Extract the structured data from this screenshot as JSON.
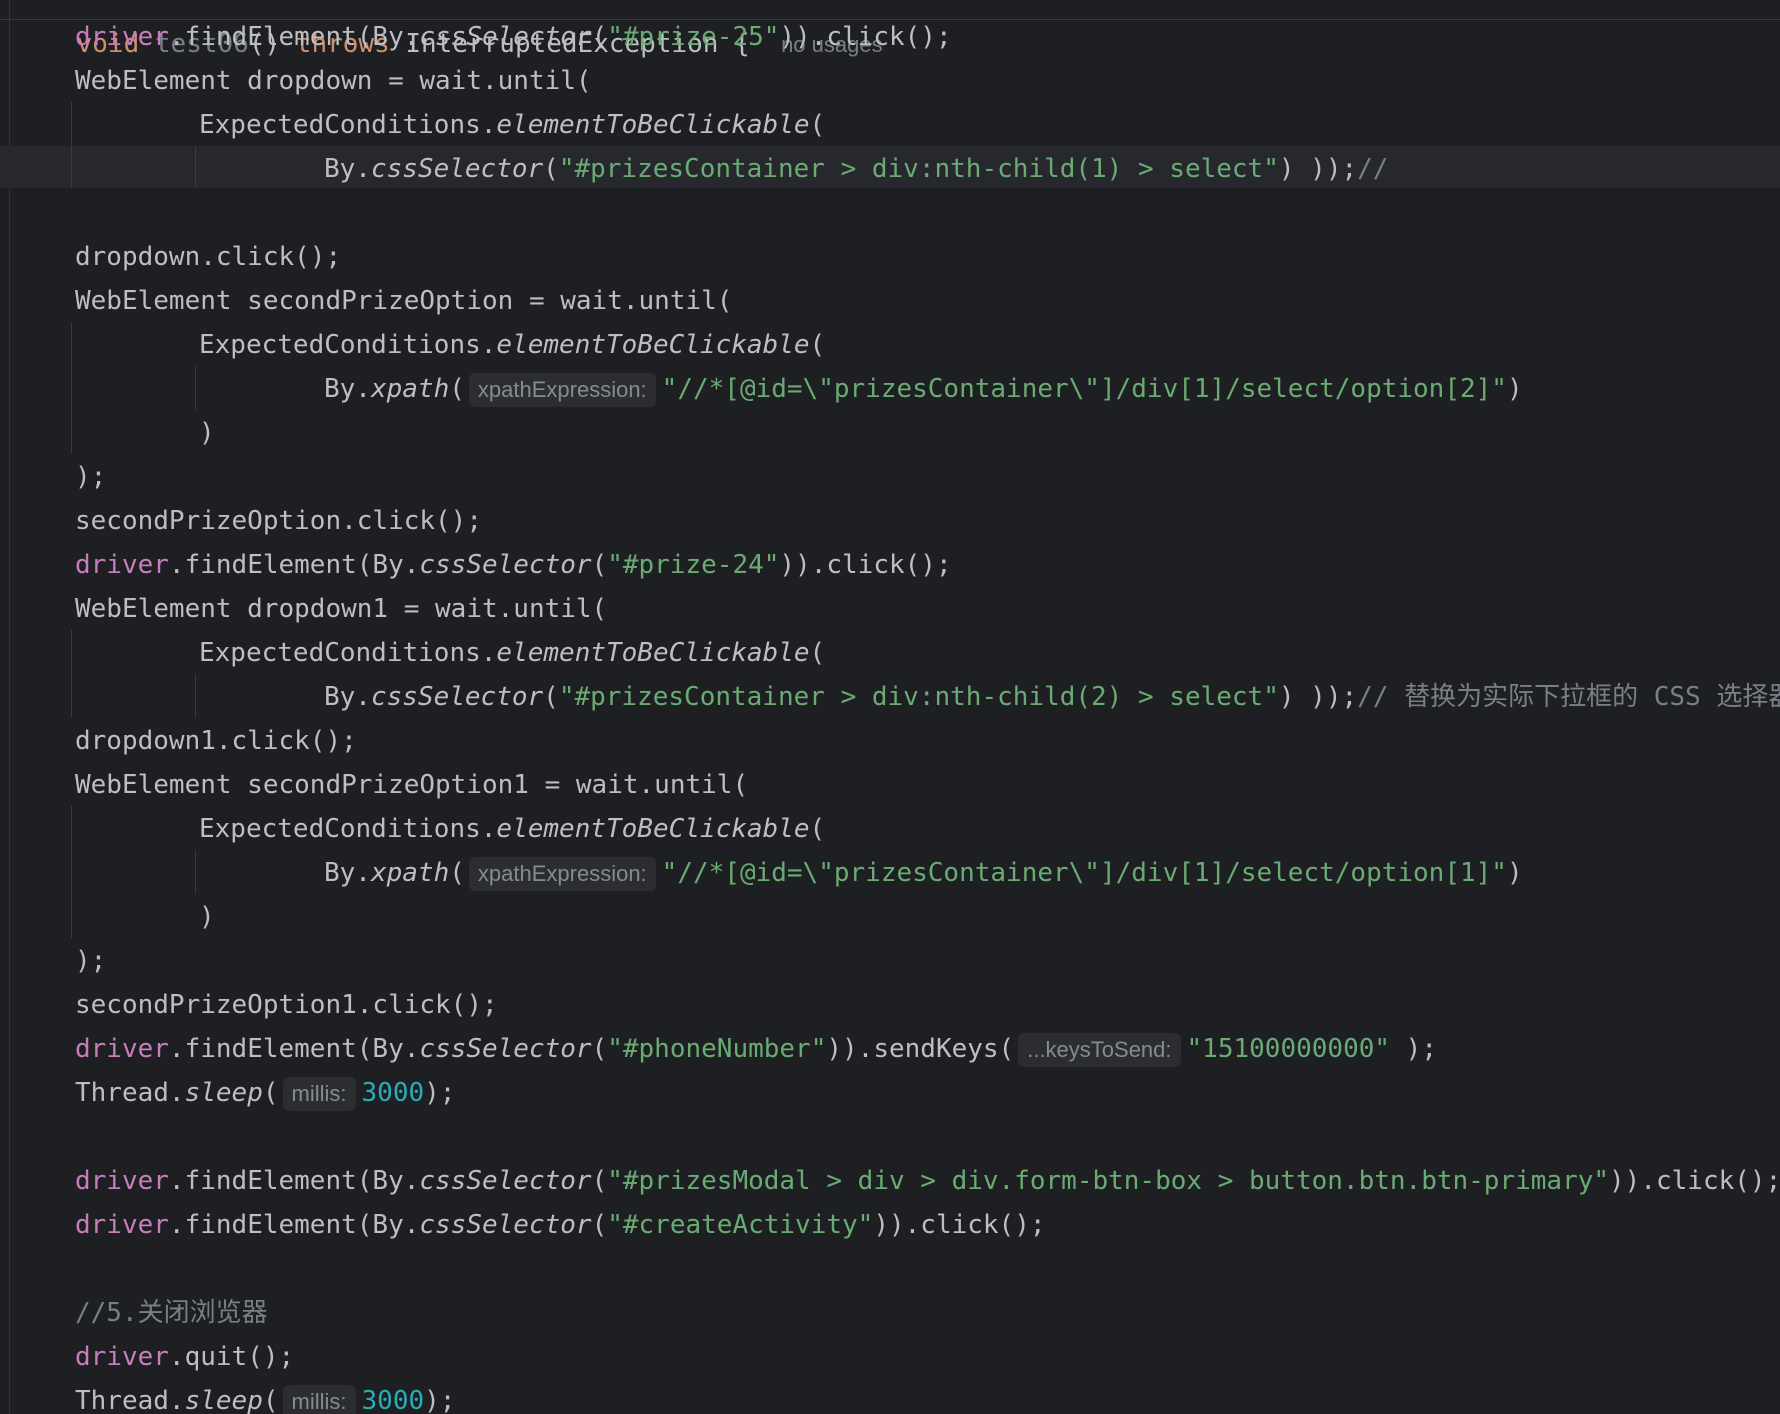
{
  "editor": {
    "header": {
      "kw_void": "void",
      "method": "test06",
      "sig_mid": "() ",
      "kw_throws": "throws",
      "exception": " InterruptedException {",
      "usages": "no usages"
    },
    "hints": {
      "xpath": "xpathExpression:",
      "keys": "...keysToSend:",
      "millis": "millis:"
    },
    "lines": {
      "l1": {
        "drv": "driver",
        "a": ".findElement(By.",
        "fn": "cssSelector",
        "b": "(",
        "s": "\"#prize-25\"",
        "c": ")).click();"
      },
      "l2": {
        "a": "WebElement dropdown = wait.until("
      },
      "l3": {
        "a": "ExpectedConditions.",
        "fn": "elementToBeClickable",
        "b": "("
      },
      "l4": {
        "a": "By.",
        "fn": "cssSelector",
        "b": "(",
        "s": "\"#prizesContainer > div:nth-child(1) > select\"",
        "c": ") ));",
        "cmt": "//"
      },
      "l6": {
        "a": "dropdown.click();"
      },
      "l7": {
        "a": "WebElement secondPrizeOption = wait.until("
      },
      "l8": {
        "a": "ExpectedConditions.",
        "fn": "elementToBeClickable",
        "b": "("
      },
      "l9": {
        "a": "By.",
        "fn": "xpath",
        "b": "(",
        "s": "\"//*[@id=\\\"prizesContainer\\\"]/div[1]/select/option[2]\"",
        "c": ")"
      },
      "l10": {
        "a": ")"
      },
      "l11": {
        "a": ");"
      },
      "l12": {
        "a": "secondPrizeOption.click();"
      },
      "l13": {
        "drv": "driver",
        "a": ".findElement(By.",
        "fn": "cssSelector",
        "b": "(",
        "s": "\"#prize-24\"",
        "c": ")).click();"
      },
      "l14": {
        "a": "WebElement dropdown1 = wait.until("
      },
      "l15": {
        "a": "ExpectedConditions.",
        "fn": "elementToBeClickable",
        "b": "("
      },
      "l16": {
        "a": "By.",
        "fn": "cssSelector",
        "b": "(",
        "s": "\"#prizesContainer > div:nth-child(2) > select\"",
        "c": ") ));",
        "cmt": "// 替换为实际下拉框的 CSS 选择器"
      },
      "l17": {
        "a": "dropdown1.click();"
      },
      "l18": {
        "a": "WebElement secondPrizeOption1 = wait.until("
      },
      "l19": {
        "a": "ExpectedConditions.",
        "fn": "elementToBeClickable",
        "b": "("
      },
      "l20": {
        "a": "By.",
        "fn": "xpath",
        "b": "(",
        "s": "\"//*[@id=\\\"prizesContainer\\\"]/div[1]/select/option[1]\"",
        "c": ")"
      },
      "l21": {
        "a": ")"
      },
      "l22": {
        "a": ");"
      },
      "l23": {
        "a": "secondPrizeOption1.click();"
      },
      "l24": {
        "drv": "driver",
        "a": ".findElement(By.",
        "fn": "cssSelector",
        "b": "(",
        "s": "\"#phoneNumber\"",
        "c": ")).sendKeys(",
        "s2": "\"15100000000\"",
        "d": " );"
      },
      "l25": {
        "a": "Thread.",
        "fn": "sleep",
        "b": "(",
        "n": "3000",
        "c": ");"
      },
      "l27": {
        "drv": "driver",
        "a": ".findElement(By.",
        "fn": "cssSelector",
        "b": "(",
        "s": "\"#prizesModal > div > div.form-btn-box > button.btn.btn-primary\"",
        "c": ")).click();"
      },
      "l28": {
        "drv": "driver",
        "a": ".findElement(By.",
        "fn": "cssSelector",
        "b": "(",
        "s": "\"#createActivity\"",
        "c": ")).click();"
      },
      "l30": {
        "cmt": "//5.关闭浏览器"
      },
      "l31": {
        "drv": "driver",
        "a": ".quit();"
      },
      "l32": {
        "a": "Thread.",
        "fn": "sleep",
        "b": "(",
        "n": "3000",
        "c": ");"
      }
    }
  }
}
